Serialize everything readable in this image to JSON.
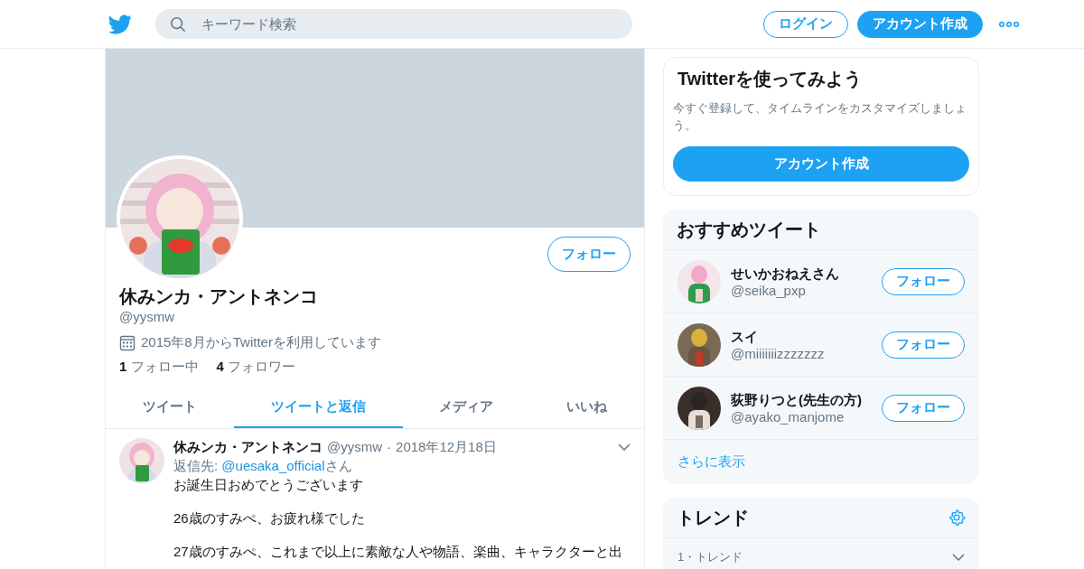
{
  "header": {
    "search_placeholder": "キーワード検索",
    "login": "ログイン",
    "signup": "アカウント作成"
  },
  "profile": {
    "name": "休みンカ・アントネンコ",
    "handle": "@yysmw",
    "joined": "2015年8月からTwitterを利用しています",
    "following_count": "1",
    "following_label": "フォロー中",
    "followers_count": "4",
    "followers_label": "フォロワー",
    "follow_button": "フォロー"
  },
  "tabs": [
    {
      "label": "ツイート",
      "selected": false
    },
    {
      "label": "ツイートと返信",
      "selected": true
    },
    {
      "label": "メディア",
      "selected": false
    },
    {
      "label": "いいね",
      "selected": false
    }
  ],
  "tweet": {
    "name": "休みンカ・アントネンコ",
    "handle": "@yysmw",
    "separator": "·",
    "date": "2018年12月18日",
    "reply_prefix": "返信先: ",
    "reply_to": "@uesaka_official",
    "reply_suffix": "さん",
    "paragraphs": [
      "お誕生日おめでとうございます",
      "26歳のすみぺ、お疲れ様でした",
      "27歳のすみぺ、これまで以上に素敵な人や物語、楽曲、キャラクターと出"
    ]
  },
  "sidebar": {
    "signup_card": {
      "title": "Twitterを使ってみよう",
      "text": "今すぐ登録して、タイムラインをカスタマイズしましょう。",
      "button": "アカウント作成"
    },
    "recommended": {
      "title": "おすすめツイート",
      "users": [
        {
          "name": "せいかおねえさん",
          "handle": "@seika_pxp",
          "button": "フォロー"
        },
        {
          "name": "スイ",
          "handle": "@miiiiiiizzzzzzz",
          "button": "フォロー"
        },
        {
          "name": "荻野りつと(先生の方)",
          "handle": "@ayako_manjome",
          "button": "フォロー"
        }
      ],
      "more": "さらに表示"
    },
    "trends": {
      "title": "トレンド",
      "items": [
        {
          "label": "1・トレンド"
        }
      ]
    }
  }
}
